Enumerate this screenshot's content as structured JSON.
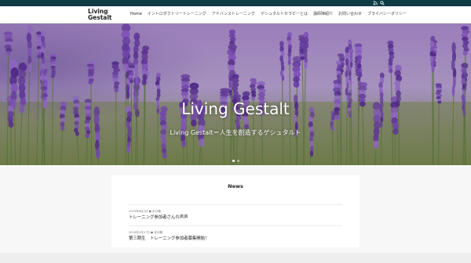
{
  "topbar": {
    "icons": [
      "rss-icon",
      "search-icon"
    ],
    "color": "#0e3b45"
  },
  "header": {
    "logo_line1": "Living",
    "logo_line2": "Gestalt",
    "nav": [
      {
        "label": "Home"
      },
      {
        "label": "イントロダクトリートレーニング"
      },
      {
        "label": "アドバンストレーニング"
      },
      {
        "label": "ゲシュタルトセラピーとは"
      },
      {
        "label": "講師陣紹介"
      },
      {
        "label": "お問い合わせ"
      },
      {
        "label": "プライバシーポリシー"
      }
    ]
  },
  "hero": {
    "title": "Living Gestalt",
    "subtitle": "Living Gestalt＝人生を創造するゲシュタルト",
    "slides_total": 2,
    "slide_active": 1
  },
  "news": {
    "heading": "News",
    "items": [
      {
        "meta": "2019年6月2日  ● 未分類",
        "title": "トレーニング参加者さんの声声"
      },
      {
        "meta": "2018年1月17日  ● 未分類",
        "title": "第三期生　トレーニング参加者募集開始！"
      }
    ]
  }
}
